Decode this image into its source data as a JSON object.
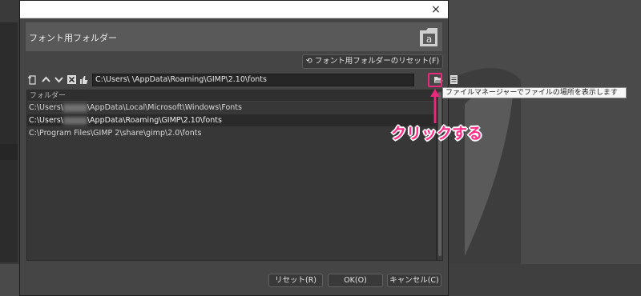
{
  "dialog": {
    "close_glyph": "×",
    "header_title": "フォント用フォルダー",
    "reset_folders_label": "フォント用フォルダーのリセット(F)"
  },
  "toolbar": {
    "path": "C:\\Users\\        \\AppData\\Roaming\\GIMP\\2.10\\fonts",
    "icons": [
      "new-folder-icon",
      "up-arrow-icon",
      "down-arrow-icon",
      "delete-icon",
      "thumb-icon",
      "open-file-icon",
      "file-manager-icon"
    ]
  },
  "list": {
    "column_header": "フォルダー",
    "rows": [
      {
        "prefix": "C:\\Users\\",
        "suffix": "\\AppData\\Local\\Microsoft\\Windows\\Fonts",
        "selected": false
      },
      {
        "prefix": "C:\\Users\\",
        "suffix": "\\AppData\\Roaming\\GIMP\\2.10\\fonts",
        "selected": true
      },
      {
        "prefix": "C:\\Program Files\\GIMP 2\\share\\gimp\\2.0\\fonts",
        "suffix": "",
        "selected": false
      }
    ]
  },
  "footer": {
    "reset_label": "リセット(R)",
    "ok_label": "OK(O)",
    "cancel_label": "キャンセル(C)"
  },
  "annotation": {
    "tooltip": "ファイルマネージャーでファイルの場所を表示します",
    "callout": "クリックする",
    "color": "#e8287a"
  }
}
